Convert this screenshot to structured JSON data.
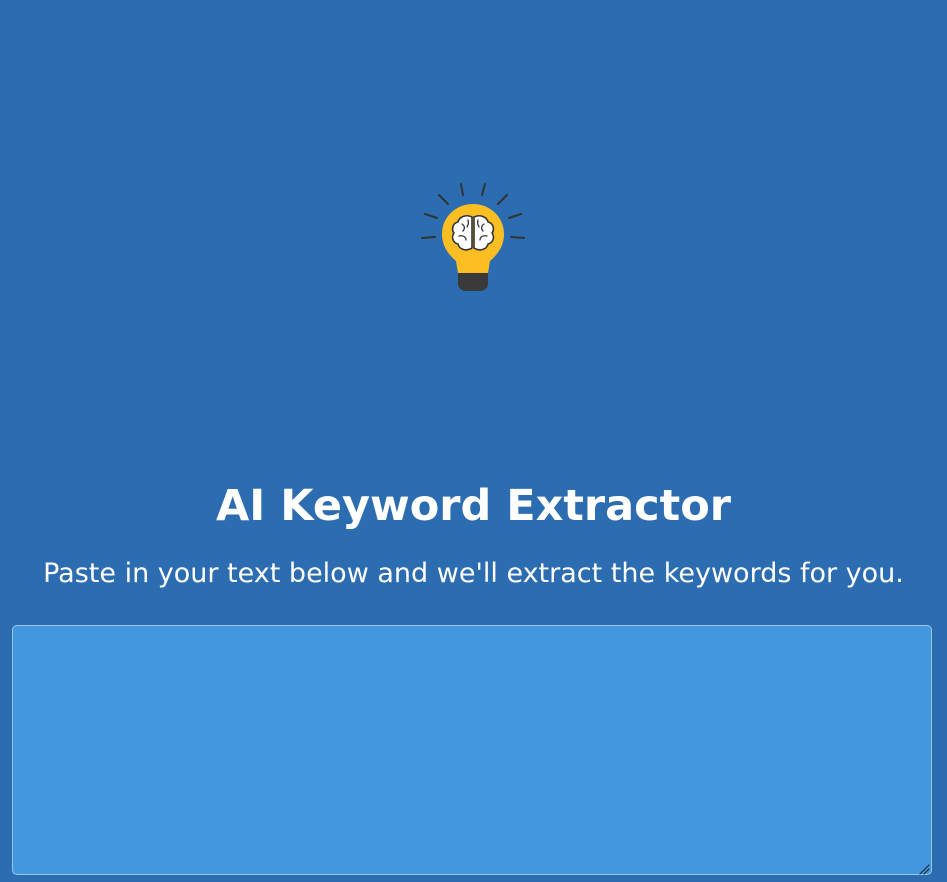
{
  "header": {
    "logo_icon": "lightbulb-brain-icon",
    "title": "AI Keyword Extractor",
    "subtitle": "Paste in your text below and we'll extract the keywords for you."
  },
  "input": {
    "value": "",
    "placeholder": ""
  },
  "colors": {
    "background": "#2c6cb0",
    "textarea_bg": "#4397df",
    "bulb_yellow": "#fbbf24",
    "bulb_base": "#3a3a3a"
  }
}
